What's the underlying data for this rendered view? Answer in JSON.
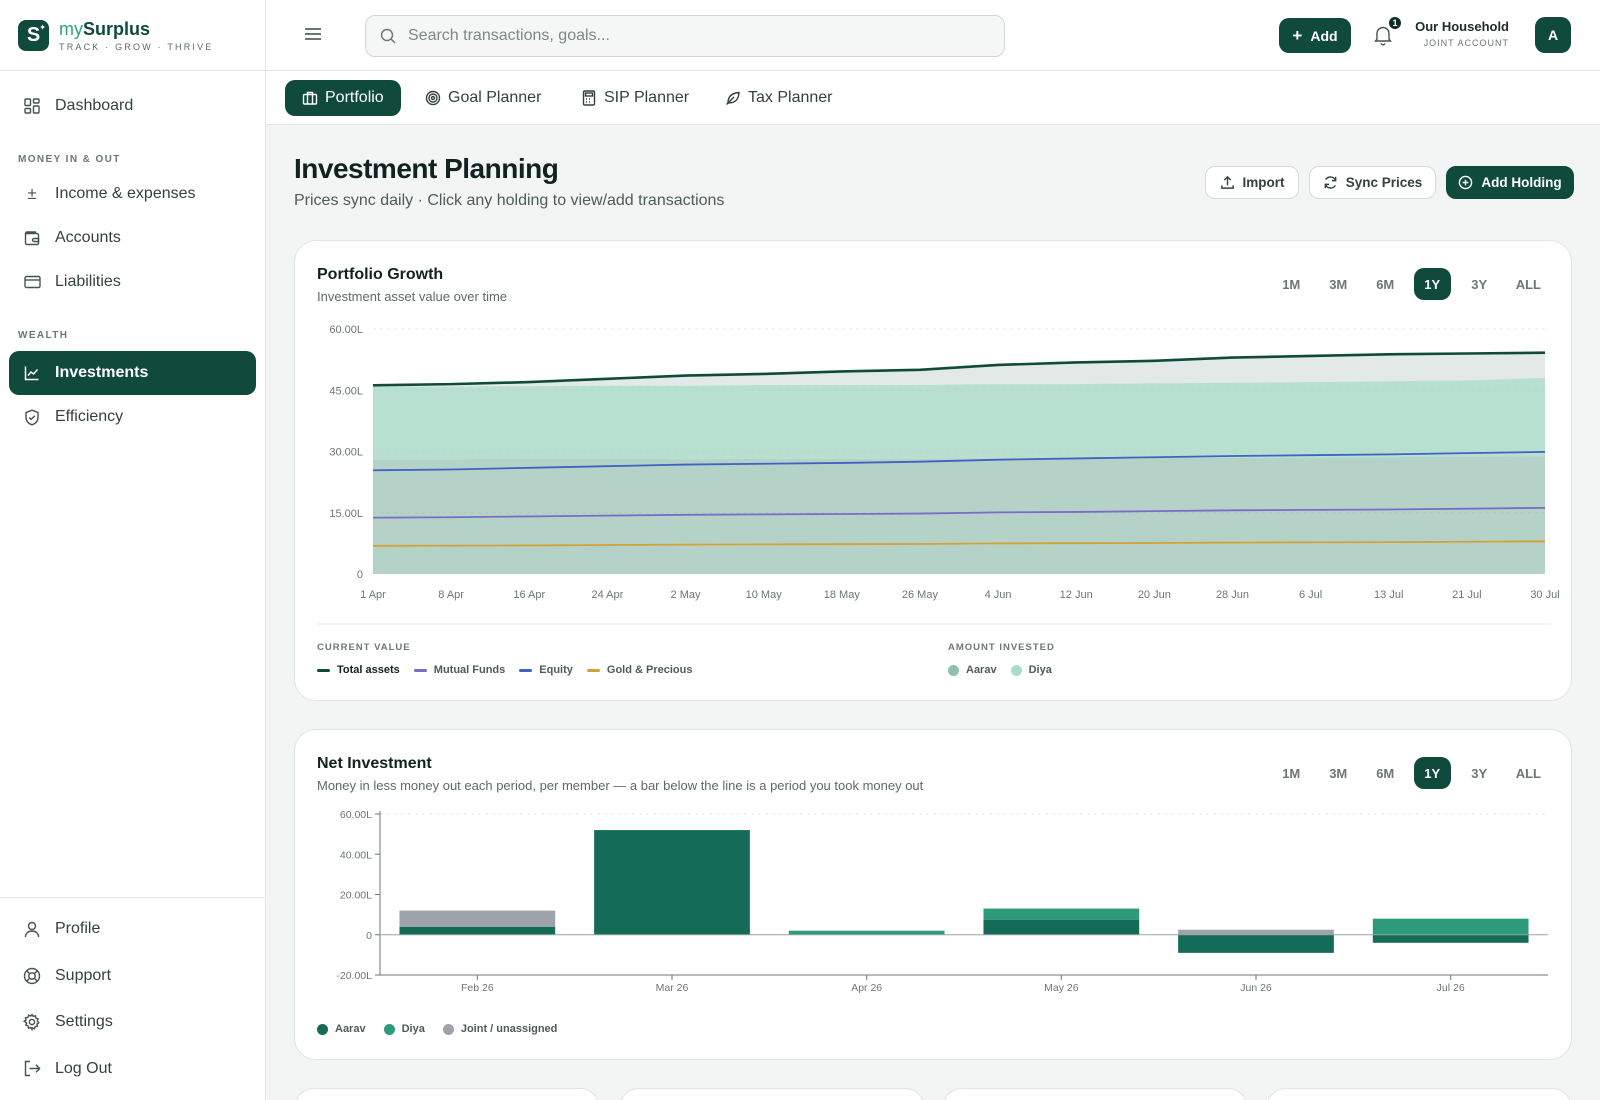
{
  "brand": {
    "name_light": "my",
    "name_bold": "Surplus",
    "tagline": "TRACK · GROW · THRIVE",
    "logo_letter": "S"
  },
  "sidebar": {
    "items": [
      {
        "label": "Dashboard",
        "icon": "grid-icon"
      }
    ],
    "section_money": "MONEY IN & OUT",
    "money_items": [
      {
        "label": "Income & expenses",
        "icon": "plus-minus-icon"
      },
      {
        "label": "Accounts",
        "icon": "wallet-icon"
      },
      {
        "label": "Liabilities",
        "icon": "credit-card-icon"
      }
    ],
    "section_wealth": "WEALTH",
    "wealth_items": [
      {
        "label": "Investments",
        "icon": "chart-line-icon",
        "active": true
      },
      {
        "label": "Efficiency",
        "icon": "shield-icon"
      }
    ],
    "bottom_items": [
      {
        "label": "Profile",
        "icon": "user-icon"
      },
      {
        "label": "Support",
        "icon": "lifebuoy-icon"
      },
      {
        "label": "Settings",
        "icon": "gear-icon"
      },
      {
        "label": "Log Out",
        "icon": "logout-icon"
      }
    ]
  },
  "topbar": {
    "search_placeholder": "Search transactions, goals...",
    "add_label": "Add",
    "notifications_count": "1",
    "household_name": "Our Household",
    "household_sub": "JOINT ACCOUNT",
    "avatar_letter": "A"
  },
  "tabs": [
    {
      "label": "Portfolio",
      "icon": "briefcase-icon",
      "active": true
    },
    {
      "label": "Goal Planner",
      "icon": "target-icon"
    },
    {
      "label": "SIP Planner",
      "icon": "calculator-icon"
    },
    {
      "label": "Tax Planner",
      "icon": "leaf-icon"
    }
  ],
  "header": {
    "title": "Investment Planning",
    "subtitle": "Prices sync daily · Click any holding to view/add transactions",
    "import_label": "Import",
    "sync_label": "Sync Prices",
    "add_holding_label": "Add Holding"
  },
  "ranges": [
    "1M",
    "3M",
    "6M",
    "1Y",
    "3Y",
    "ALL"
  ],
  "active_range": "1Y",
  "growth": {
    "title": "Portfolio Growth",
    "subtitle": "Investment asset value over time",
    "legend_current_head": "CURRENT VALUE",
    "legend_invested_head": "AMOUNT INVESTED",
    "legend_current": [
      {
        "name": "Total assets",
        "color": "#0f4a3c"
      },
      {
        "name": "Mutual Funds",
        "color": "#7b6cc7"
      },
      {
        "name": "Equity",
        "color": "#3f63c2"
      },
      {
        "name": "Gold & Precious",
        "color": "#d4a23a"
      }
    ],
    "legend_invested": [
      {
        "name": "Aarav",
        "color": "#8fbfaf"
      },
      {
        "name": "Diya",
        "color": "#a9dcca"
      }
    ]
  },
  "net": {
    "title": "Net Investment",
    "subtitle": "Money in less money out each period, per member — a bar below the line is a period you took money out",
    "legend": [
      {
        "name": "Aarav",
        "color": "#136b58"
      },
      {
        "name": "Diya",
        "color": "#2e9a7c"
      },
      {
        "name": "Joint / unassigned",
        "color": "#9ea3aa"
      }
    ]
  },
  "chart_data": [
    {
      "type": "area",
      "title": "Portfolio Growth",
      "ytick_labels": [
        "0",
        "15.00L",
        "30.00L",
        "45.00L",
        "60.00L"
      ],
      "ylim": [
        0,
        60
      ],
      "x_labels": [
        "1 Apr",
        "8 Apr",
        "16 Apr",
        "24 Apr",
        "2 May",
        "10 May",
        "18 May",
        "26 May",
        "4 Jun",
        "12 Jun",
        "20 Jun",
        "28 Jun",
        "6 Jul",
        "13 Jul",
        "21 Jul",
        "30 Jul"
      ],
      "grid": true,
      "series": [
        {
          "name": "Total assets",
          "kind": "line",
          "color": "#0f4a3c",
          "values": [
            46.2,
            46.5,
            47.0,
            47.8,
            48.6,
            49.0,
            49.6,
            50.0,
            51.2,
            51.8,
            52.2,
            53.0,
            53.4,
            53.8,
            54.0,
            54.2
          ]
        },
        {
          "name": "Equity",
          "kind": "line",
          "color": "#3f63c2",
          "values": [
            25.4,
            25.6,
            26.0,
            26.4,
            26.8,
            27.0,
            27.2,
            27.5,
            28.0,
            28.3,
            28.6,
            28.9,
            29.1,
            29.3,
            29.6,
            29.9
          ]
        },
        {
          "name": "Mutual Funds",
          "kind": "line",
          "color": "#7b6cc7",
          "values": [
            13.8,
            13.9,
            14.1,
            14.3,
            14.5,
            14.6,
            14.7,
            14.8,
            15.1,
            15.2,
            15.4,
            15.6,
            15.7,
            15.8,
            16.0,
            16.2
          ]
        },
        {
          "name": "Gold & Precious",
          "kind": "line",
          "color": "#d4a23a",
          "values": [
            6.9,
            6.95,
            7.0,
            7.1,
            7.2,
            7.25,
            7.3,
            7.35,
            7.5,
            7.55,
            7.6,
            7.7,
            7.75,
            7.8,
            7.9,
            8.0
          ]
        },
        {
          "name": "Aarav",
          "kind": "area",
          "color": "#8fbfaf",
          "values": [
            28.0,
            28.0,
            28.1,
            28.1,
            28.1,
            28.2,
            28.2,
            28.2,
            28.3,
            28.3,
            28.4,
            28.4,
            28.5,
            28.6,
            28.7,
            28.8
          ]
        },
        {
          "name": "Diya",
          "kind": "area",
          "color": "#a9dcca",
          "values": [
            17.8,
            17.9,
            17.9,
            18.0,
            18.0,
            18.1,
            18.1,
            18.1,
            18.2,
            18.2,
            18.3,
            18.4,
            18.5,
            18.6,
            18.7,
            19.2
          ]
        }
      ]
    },
    {
      "type": "bar",
      "title": "Net Investment",
      "categories": [
        "Feb 26",
        "Mar 26",
        "Apr 26",
        "May 26",
        "Jun 26",
        "Jul 26"
      ],
      "ytick_labels": [
        "-20.00L",
        "0",
        "20.00L",
        "40.00L",
        "60.00L"
      ],
      "ylim": [
        -20,
        60
      ],
      "stacked": true,
      "series": [
        {
          "name": "Aarav",
          "color": "#136b58",
          "values": [
            4,
            52,
            0,
            7.5,
            -9,
            -4
          ]
        },
        {
          "name": "Diya",
          "color": "#2e9a7c",
          "values": [
            0,
            0,
            2,
            5.5,
            0,
            8
          ]
        },
        {
          "name": "Joint / unassigned",
          "color": "#9ea3aa",
          "values": [
            8,
            0,
            0,
            0,
            2.5,
            0
          ]
        }
      ]
    }
  ]
}
